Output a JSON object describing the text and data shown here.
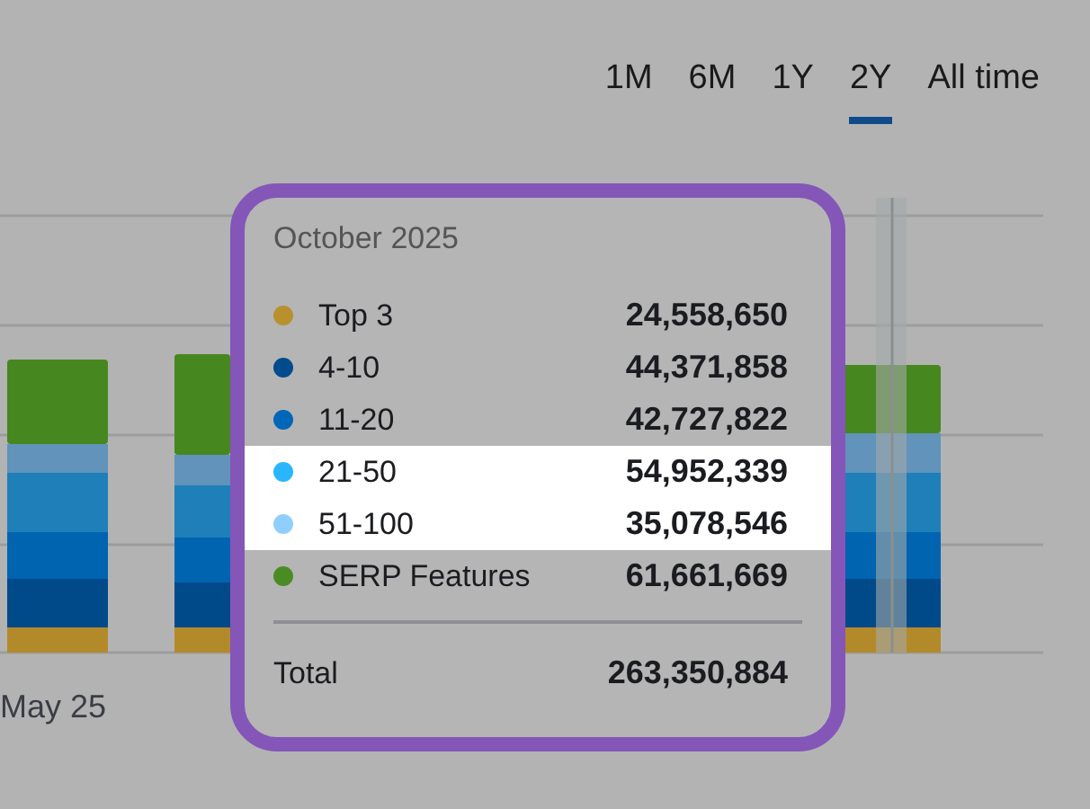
{
  "ranges": [
    {
      "label": "1M",
      "selected": false
    },
    {
      "label": "6M",
      "selected": false
    },
    {
      "label": "1Y",
      "selected": false
    },
    {
      "label": "2Y",
      "selected": true
    },
    {
      "label": "All time",
      "selected": false
    }
  ],
  "x_labels": [
    "May 25"
  ],
  "tooltip": {
    "title": "October 2025",
    "items": [
      {
        "label": "Top 3",
        "value": "24,558,650",
        "color": "#b8902e",
        "selected": false
      },
      {
        "label": "4-10",
        "value": "44,371,858",
        "color": "#004b8c",
        "selected": false
      },
      {
        "label": "11-20",
        "value": "42,727,822",
        "color": "#0066b8",
        "selected": false
      },
      {
        "label": "21-50",
        "value": "54,952,339",
        "color": "#29b6ff",
        "selected": true
      },
      {
        "label": "51-100",
        "value": "35,078,546",
        "color": "#8fcfff",
        "selected": true
      },
      {
        "label": "SERP Features",
        "value": "61,661,669",
        "color": "#4a8c24",
        "selected": false
      }
    ],
    "total": {
      "label": "Total",
      "value": "263,350,884"
    }
  }
}
